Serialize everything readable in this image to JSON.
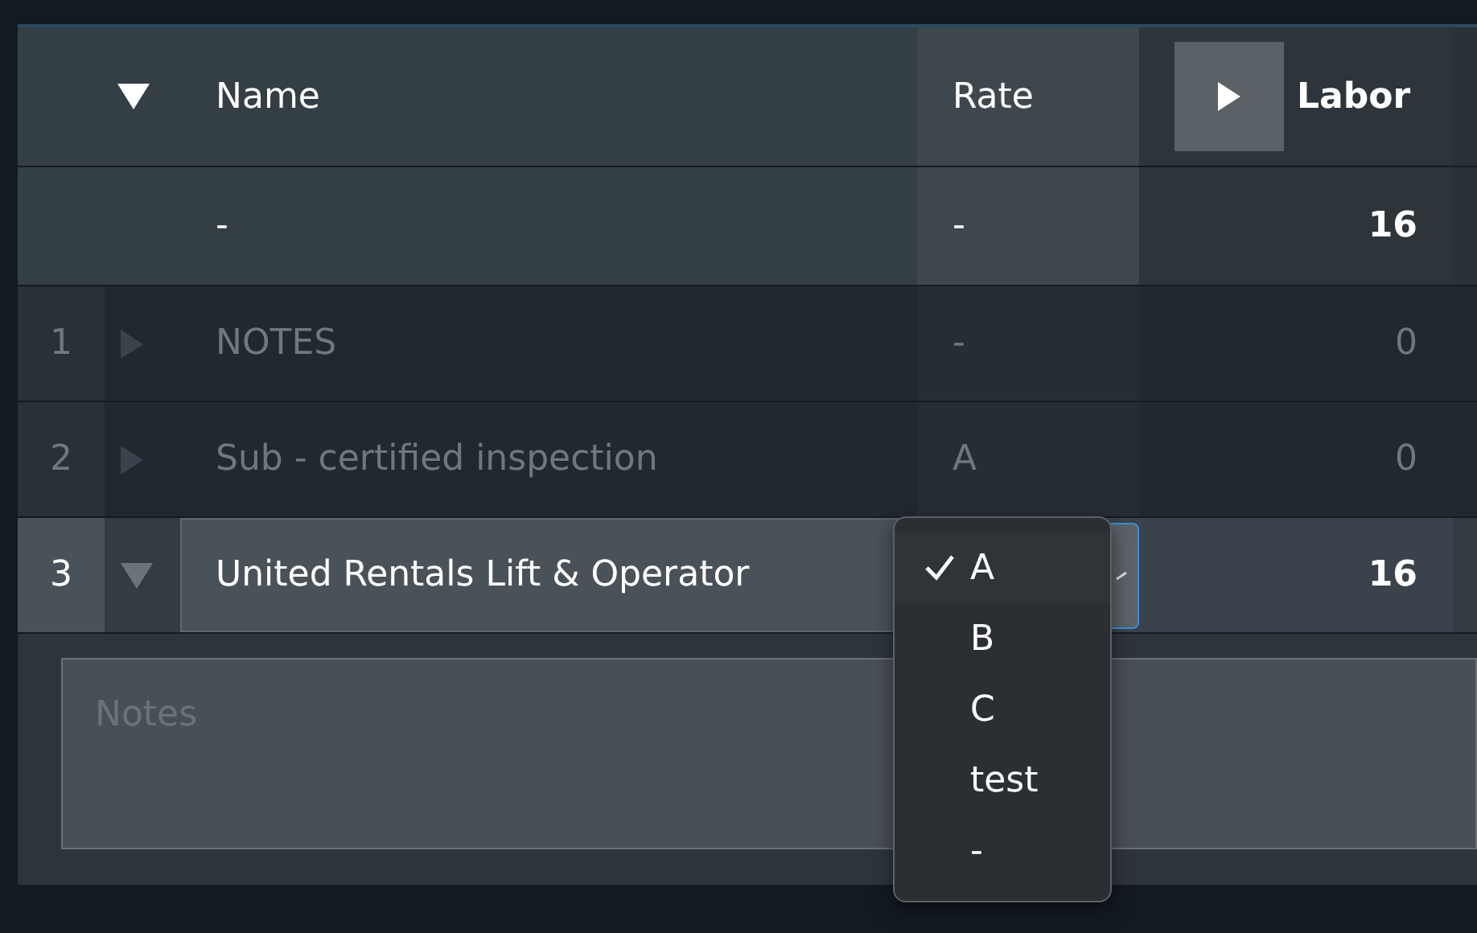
{
  "header": {
    "toggle": {
      "expanded": true
    },
    "columns": [
      {
        "label": "Name"
      },
      {
        "label": "Rate"
      },
      {
        "label": "Labor",
        "collapsed": true
      }
    ]
  },
  "summary": {
    "name": "-",
    "rate": "-",
    "labor": "16"
  },
  "rows": [
    {
      "index": "1",
      "name": "NOTES",
      "rate": "-",
      "labor": "0",
      "expanded": false,
      "selected": false
    },
    {
      "index": "2",
      "name": "Sub - certified inspection",
      "rate": "A",
      "labor": "0",
      "expanded": false,
      "selected": false
    },
    {
      "index": "3",
      "name": "United Rentals Lift & Operator",
      "labor": "16",
      "expanded": true,
      "selected": true
    }
  ],
  "notes": {
    "placeholder": "Notes"
  },
  "rate_menu": {
    "options": [
      {
        "label": "A",
        "selected": true
      },
      {
        "label": "B",
        "selected": false
      },
      {
        "label": "C",
        "selected": false
      },
      {
        "label": "test",
        "selected": false
      },
      {
        "label": "-",
        "selected": false
      }
    ]
  }
}
